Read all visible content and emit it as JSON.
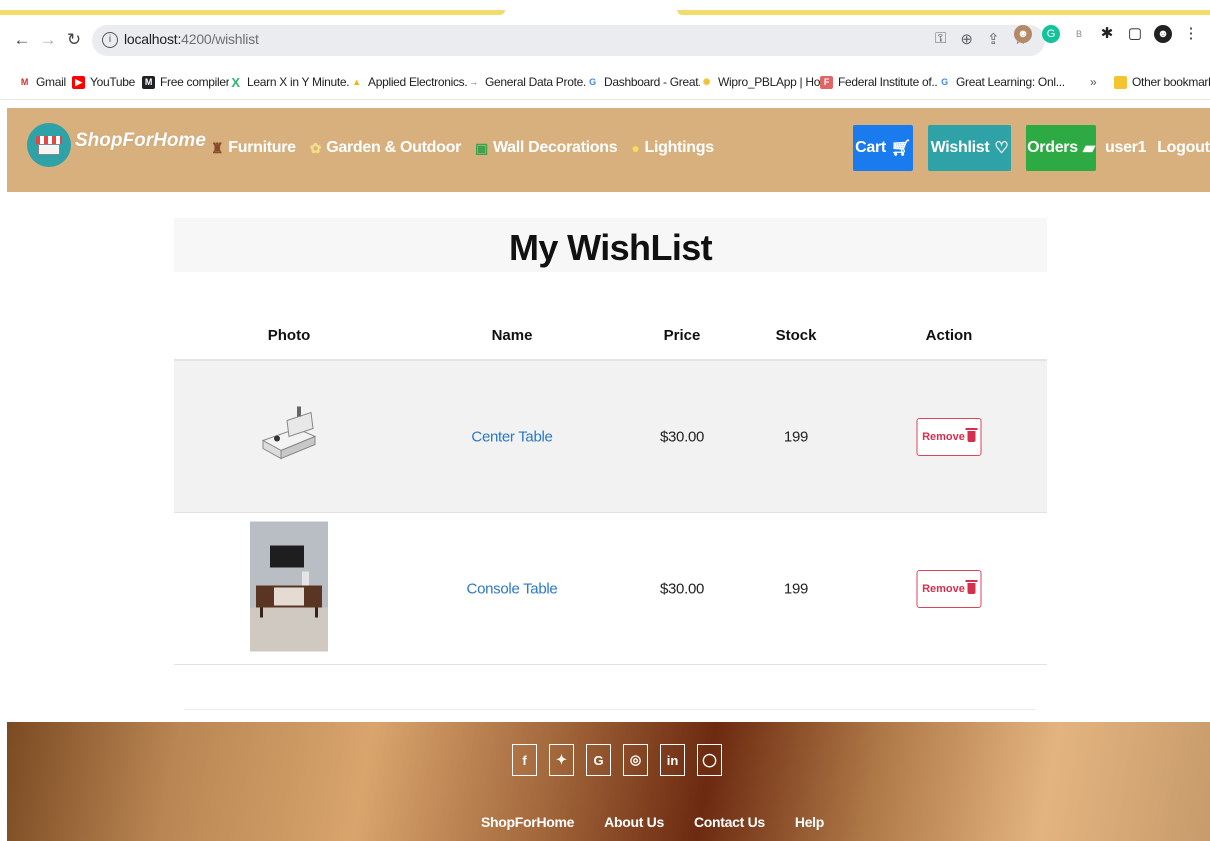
{
  "browser": {
    "url_host": "localhost:",
    "url_rest": "4200/wishlist",
    "bookmarks": [
      {
        "label": "Gmail",
        "icon": "gmail-icon",
        "color": "#d93025",
        "glyph": "M"
      },
      {
        "label": "YouTube",
        "icon": "youtube-icon",
        "color": "#ff0000",
        "glyph": "▶"
      },
      {
        "label": "Free compiler",
        "icon": "compiler-icon",
        "color": "#202124",
        "glyph": "M"
      },
      {
        "label": "Learn X in Y Minute...",
        "icon": "learnx-icon",
        "color": "#2bb673",
        "glyph": "X"
      },
      {
        "label": "Applied Electronics...",
        "icon": "drive-icon",
        "color": "#f4b400",
        "glyph": "▲"
      },
      {
        "label": "General Data Prote...",
        "icon": "arrow-icon",
        "color": "#5f6368",
        "glyph": "→"
      },
      {
        "label": "Dashboard - Great...",
        "icon": "google-icon",
        "color": "#4285f4",
        "glyph": "G"
      },
      {
        "label": "Wipro_PBLApp | Ho...",
        "icon": "wipro-icon",
        "color": "#f1c232",
        "glyph": "✺"
      },
      {
        "label": "Federal Institute of...",
        "icon": "federal-icon",
        "color": "#e06666",
        "glyph": "F"
      },
      {
        "label": "Great Learning: Onl...",
        "icon": "google-icon",
        "color": "#4285f4",
        "glyph": "G"
      }
    ],
    "other_bookmarks": "Other bookmarks"
  },
  "navbar": {
    "brand": "ShopForHome",
    "links": [
      {
        "label": "Furniture",
        "icon": "chair-icon",
        "glyph": "♜",
        "color": "#8a4b2a"
      },
      {
        "label": "Garden & Outdoor",
        "icon": "flower-icon",
        "glyph": "✿",
        "color": "#e7c65b"
      },
      {
        "label": "Wall Decorations",
        "icon": "picture-icon",
        "glyph": "▣",
        "color": "#3fa34d"
      },
      {
        "label": "Lightings",
        "icon": "bulb-icon",
        "glyph": "●",
        "color": "#f2d34b"
      }
    ],
    "cart": "Cart",
    "wishlist": "Wishlist",
    "orders": "Orders",
    "user": "user1",
    "logout": "Logout"
  },
  "page": {
    "title": "My WishList"
  },
  "table": {
    "headers": {
      "photo": "Photo",
      "name": "Name",
      "price": "Price",
      "stock": "Stock",
      "action": "Action"
    },
    "rows": [
      {
        "name": "Center Table",
        "price": "$30.00",
        "stock": "199",
        "action": "Remove"
      },
      {
        "name": "Console Table",
        "price": "$30.00",
        "stock": "199",
        "action": "Remove"
      }
    ]
  },
  "footer": {
    "social": [
      {
        "glyph": "f",
        "icon": "facebook-icon"
      },
      {
        "glyph": "🐦",
        "icon": "twitter-icon"
      },
      {
        "glyph": "G",
        "icon": "google-icon"
      },
      {
        "glyph": "◎",
        "icon": "instagram-icon"
      },
      {
        "glyph": "in",
        "icon": "linkedin-icon"
      },
      {
        "glyph": "◯",
        "icon": "github-icon"
      }
    ],
    "links": [
      "ShopForHome",
      "About Us",
      "Contact Us",
      "Help"
    ]
  }
}
